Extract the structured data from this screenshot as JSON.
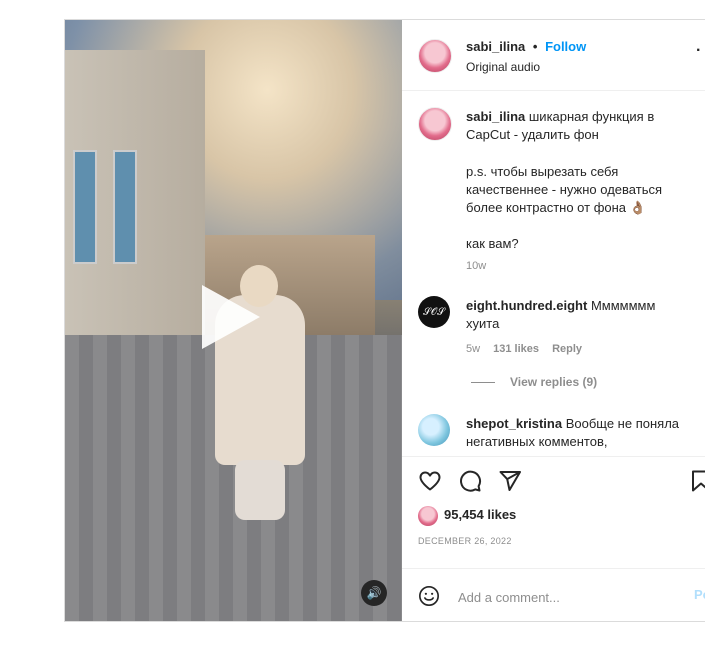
{
  "header": {
    "username": "sabi_ilina",
    "separator": "•",
    "follow_label": "Follow",
    "subtitle": "Original audio",
    "more_icon": "more-options-icon",
    "more_glyph": "·"
  },
  "media": {
    "play_icon": "play-icon",
    "mute_icon": "volume-icon",
    "mute_glyph": "🔊"
  },
  "caption": {
    "username": "sabi_ilina",
    "text_1": "шикарная функция в CapCut - удалить фон",
    "text_2": "p.s. чтобы вырезать себя качественнее - нужно одеваться более контрастно от фона 👌🏽",
    "text_3": "как вам?",
    "time": "10w"
  },
  "comments": [
    {
      "username": "eight.hundred.eight",
      "text": "Ммммммм хуита",
      "time": "5w",
      "likes": "131 likes",
      "reply_label": "Reply",
      "avatar_text": "𝒮𝒪𝒮",
      "view_replies": "View replies (9)"
    },
    {
      "username": "shepot_kristina",
      "text": "Вообще не поняла негативных комментов,"
    }
  ],
  "actions": {
    "like_icon": "heart-icon",
    "comment_icon": "comment-icon",
    "share_icon": "share-icon",
    "save_icon": "bookmark-icon",
    "likes_count": "95,454 likes",
    "date": "DECEMBER 26, 2022"
  },
  "add_comment": {
    "emoji_icon": "emoji-icon",
    "placeholder": "Add a comment...",
    "post_label": "Po"
  },
  "colors": {
    "accent": "#0095f6",
    "muted": "#8e8e8e",
    "text": "#262626"
  }
}
